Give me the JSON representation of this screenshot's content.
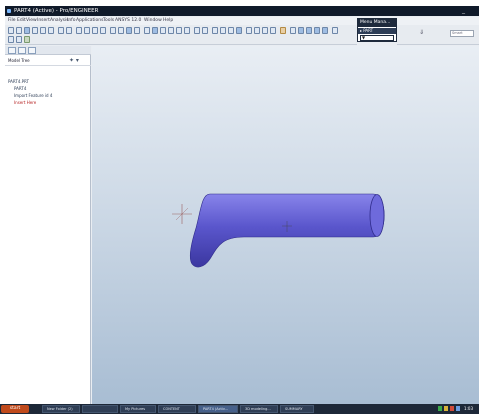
{
  "window": {
    "title": "PART4 (Active) - Pro/ENGINEER",
    "minimize_glyph": "_"
  },
  "menubar": {
    "items": [
      "File",
      "Edit",
      "View",
      "Insert",
      "Analysis",
      "Info",
      "Applications",
      "Tools",
      "ANSYS 12.0",
      "Window",
      "Help"
    ]
  },
  "menu_manager": {
    "title": "Menu Mana...",
    "item": "▸ PART",
    "selected": "▼"
  },
  "right_toolbar": {
    "search_placeholder": "Smart",
    "arrow_glyph": "⇓"
  },
  "navigator": {
    "header_label": "Model Tree",
    "header_options": "✦ ▾",
    "tree": {
      "root": "PART4.PRT",
      "items": [
        {
          "label": "PART4",
          "icon": "feature-icon"
        },
        {
          "label": "Import Feature id 4",
          "icon": "import-feature-icon"
        },
        {
          "label": "Insert Here",
          "icon": "insert-here-icon"
        }
      ]
    }
  },
  "viewport": {
    "model": "bent-pipe-solid",
    "colors": {
      "model": "#5a56cc",
      "model_shade": "#3b37a0",
      "model_highlight": "#8884ea",
      "background_top": "#e9eef4",
      "background_bottom": "#a8bdd3"
    }
  },
  "taskbar": {
    "start_label": "start",
    "items": [
      {
        "label": "New Folder (2)"
      },
      {
        "label": ""
      },
      {
        "label": "My Pictures"
      },
      {
        "label": "CONTENT"
      },
      {
        "label": "PART4 (Activ...",
        "active": true
      },
      {
        "label": "3D modeling..."
      },
      {
        "label": "SUMMARY"
      }
    ],
    "clock": "1:03"
  }
}
